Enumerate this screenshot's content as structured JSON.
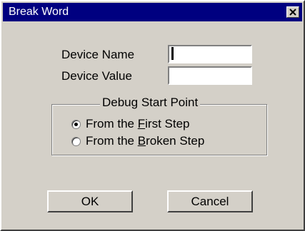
{
  "window": {
    "title": "Break Word"
  },
  "fields": {
    "device_name_label": "Device Name",
    "device_name_value": "",
    "device_value_label": "Device Value",
    "device_value_value": ""
  },
  "debug_group": {
    "title": "Debug Start Point",
    "options": [
      {
        "prefix": "From the ",
        "mnemonic": "F",
        "suffix": "irst Step",
        "selected": true
      },
      {
        "prefix": "From the ",
        "mnemonic": "B",
        "suffix": "roken Step",
        "selected": false
      }
    ]
  },
  "buttons": {
    "ok": "OK",
    "cancel": "Cancel"
  }
}
